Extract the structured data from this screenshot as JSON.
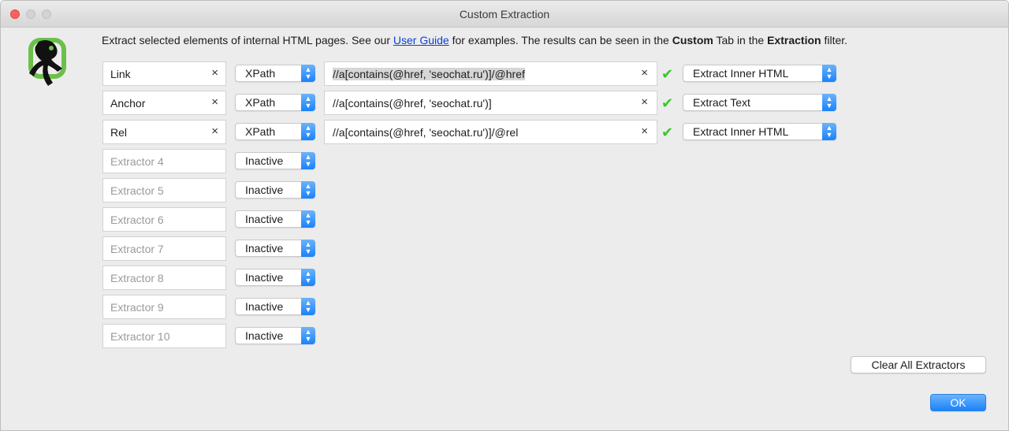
{
  "window": {
    "title": "Custom Extraction"
  },
  "intro": {
    "text_before": "Extract selected elements of internal HTML pages. See our ",
    "link": "User Guide",
    "text_middle": " for examples. The results can be seen in the ",
    "bold1": "Custom",
    "text_after_bold1": " Tab in the ",
    "bold2": "Extraction",
    "text_end": " filter."
  },
  "extractors": [
    {
      "name": "Link",
      "type": "XPath",
      "expression": "//a[contains(@href, 'seochat.ru')]/@href",
      "mode": "Extract Inner HTML",
      "valid": true
    },
    {
      "name": "Anchor",
      "type": "XPath",
      "expression": "//a[contains(@href, 'seochat.ru')]",
      "mode": "Extract Text",
      "valid": true
    },
    {
      "name": "Rel",
      "type": "XPath",
      "expression": "//a[contains(@href, 'seochat.ru')]/@rel",
      "mode": "Extract Inner HTML",
      "valid": true
    },
    {
      "placeholder": "Extractor 4",
      "type": "Inactive"
    },
    {
      "placeholder": "Extractor 5",
      "type": "Inactive"
    },
    {
      "placeholder": "Extractor 6",
      "type": "Inactive"
    },
    {
      "placeholder": "Extractor 7",
      "type": "Inactive"
    },
    {
      "placeholder": "Extractor 8",
      "type": "Inactive"
    },
    {
      "placeholder": "Extractor 9",
      "type": "Inactive"
    },
    {
      "placeholder": "Extractor 10",
      "type": "Inactive"
    }
  ],
  "buttons": {
    "clear_all": "Clear All Extractors",
    "ok": "OK"
  },
  "icons": {
    "clear": "×",
    "valid": "✔",
    "chevron": "▲▼"
  },
  "colors": {
    "accent": "#1a82fb",
    "valid": "#39c72a",
    "link": "#0b3fd6",
    "logo_green": "#6cc04a"
  }
}
